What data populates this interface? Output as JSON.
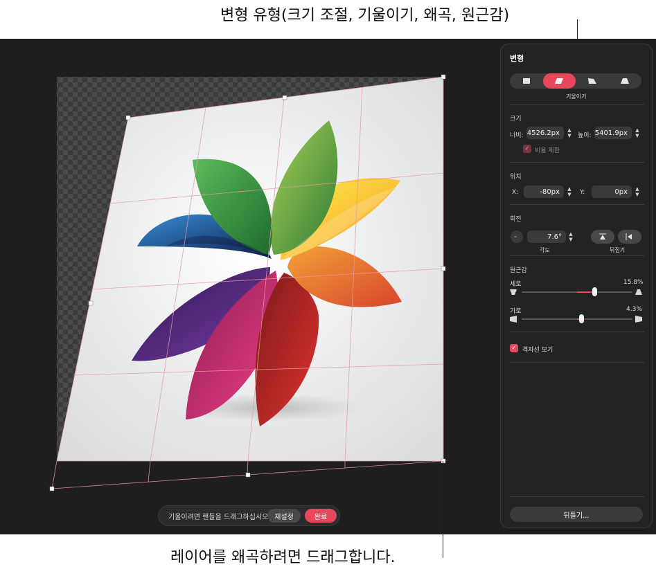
{
  "callouts": {
    "top": "변형 유형(크기 조절, 기울이기, 왜곡, 원근감)",
    "bottom": "레이어를 왜곡하려면 드래그합니다."
  },
  "hint_bar": {
    "text": "기울이려면 핸들을 드래그하십시오.",
    "reset_label": "재설정",
    "done_label": "완료"
  },
  "panel": {
    "title": "변형",
    "transform_modes": [
      "scale-icon",
      "skew-icon",
      "distort-icon",
      "perspective-icon"
    ],
    "active_mode_caption": "기울이기",
    "size": {
      "label": "크기",
      "width_label": "너비:",
      "width_value": "4526.2px",
      "height_label": "높이:",
      "height_value": "5401.9px",
      "constrain_label": "비율 제한"
    },
    "position": {
      "label": "위치",
      "x_label": "X:",
      "x_value": "-80px",
      "y_label": "Y:",
      "y_value": "0px"
    },
    "rotation": {
      "label": "회전",
      "angle_value": "7.6°",
      "angle_caption": "각도",
      "flip_caption": "뒤집기"
    },
    "perspective": {
      "label": "원근감",
      "vertical_label": "세로",
      "vertical_value": "15.8%",
      "vertical_fraction": 0.158,
      "horizontal_label": "가로",
      "horizontal_value": "4.3%",
      "horizontal_fraction": 0.043
    },
    "show_grid_label": "격자선 보기",
    "flip_button_label": "뒤틀기..."
  },
  "colors": {
    "accent": "#e8475c",
    "canvas_bg": "#1f1f1f",
    "panel_bg": "#232325",
    "grid_line": "#e89aa2"
  }
}
